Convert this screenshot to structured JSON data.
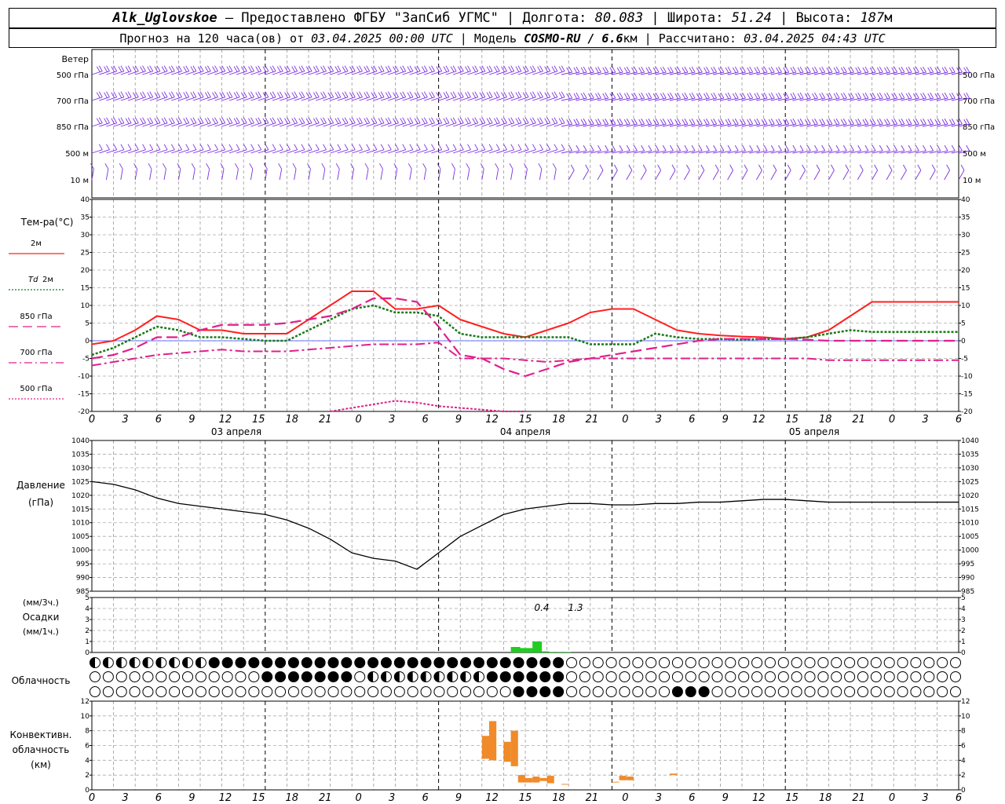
{
  "header": {
    "station": "Alk_Uglovskoe",
    "provider": "– Предоставлено ФГБУ \"ЗапСиб УГМС\"",
    "lon_label": "Долгота:",
    "lon": "80.083",
    "lat_label": "Широта:",
    "lat": "51.24",
    "alt_label": "Высота:",
    "alt": "187",
    "alt_unit": "м",
    "forecast_label": "Прогноз на 120 часа(ов) от",
    "forecast_start": "03.04.2025 00:00 UTC",
    "model_label": "Модель",
    "model": "COSMO-RU / 6.6",
    "model_unit": "км",
    "computed_label": "Рассчитано:",
    "computed": "03.04.2025 04:43 UTC"
  },
  "time_axis": {
    "hour_labels": [
      "0",
      "3",
      "6",
      "9",
      "12",
      "15",
      "18",
      "21",
      "0",
      "3",
      "6",
      "9",
      "12",
      "15",
      "18",
      "21",
      "0",
      "3",
      "6",
      "9",
      "12",
      "15",
      "18",
      "21",
      "0",
      "3",
      "6"
    ],
    "day_labels": [
      "03 апреля",
      "04 апреля",
      "05 апреля"
    ]
  },
  "wind": {
    "title": "Ветер",
    "levels": [
      "500 гПа",
      "700 гПа",
      "850 гПа",
      "500 м",
      "10  м"
    ],
    "color": "#7b2fe0"
  },
  "temperature": {
    "title": "Тем-ра(°C)",
    "legend": [
      {
        "label": "2м",
        "color": "#ff2020",
        "style": "solid"
      },
      {
        "label_it": "Td",
        "label": "2м",
        "color": "#1a7a1a",
        "style": "dotted"
      },
      {
        "label": "850 гПа",
        "color": "#e0208a",
        "style": "longdash"
      },
      {
        "label": "700 гПа",
        "color": "#e0208a",
        "style": "dashdot"
      },
      {
        "label": "500 гПа",
        "color": "#e0208a",
        "style": "dotted"
      }
    ],
    "y_ticks": [
      "40",
      "35",
      "30",
      "25",
      "20",
      "15",
      "10",
      "5",
      "0",
      "-5",
      "-10",
      "-15",
      "-20"
    ]
  },
  "pressure": {
    "title": "Давление",
    "unit": "(гПа)",
    "y_ticks": [
      "1040",
      "1035",
      "1030",
      "1025",
      "1020",
      "1015",
      "1010",
      "1005",
      "1000",
      "995",
      "990",
      "985"
    ]
  },
  "precip": {
    "unit3": "(мм/3ч.)",
    "title": "Осадки",
    "unit1": "(мм/1ч.)",
    "y_ticks": [
      "5",
      "4",
      "3",
      "2",
      "1",
      "0"
    ],
    "annotations": [
      "0.4",
      "1.3"
    ],
    "color": "#22cc22"
  },
  "cloud": {
    "title": "Облачность"
  },
  "convective": {
    "title1": "Конвективн.",
    "title2": "облачность",
    "unit": "(км)",
    "y_ticks": [
      "12",
      "10",
      "8",
      "6",
      "4",
      "2",
      "0"
    ],
    "color": "#f08a2a"
  },
  "chart_data": [
    {
      "type": "line",
      "title": "Тем-ра(°C)",
      "x_hours": [
        0,
        3,
        6,
        9,
        12,
        15,
        18,
        21,
        24,
        27,
        30,
        33,
        36,
        39,
        42,
        45,
        48,
        51,
        54,
        57,
        60,
        63,
        66,
        69,
        72,
        75,
        78,
        81,
        84,
        87,
        90,
        93,
        96,
        99,
        102,
        105,
        108,
        111,
        114,
        117,
        120
      ],
      "ylim": [
        -20,
        40
      ],
      "series": [
        {
          "name": "2м",
          "values": [
            -1,
            0,
            3,
            7,
            6,
            3,
            3,
            2,
            2,
            2,
            6,
            10,
            14,
            14,
            9,
            9,
            10,
            6,
            4,
            2,
            1,
            3,
            5,
            8,
            9,
            9,
            6,
            3,
            2,
            1.5,
            1.2,
            1,
            0.5,
            1,
            3,
            7,
            11,
            11,
            11,
            11,
            11
          ]
        },
        {
          "name": "Td 2м",
          "values": [
            -4,
            -2,
            1,
            4,
            3,
            1,
            1,
            0.5,
            0,
            0,
            3,
            6,
            9,
            10,
            8,
            8,
            7,
            2,
            1,
            1,
            1,
            1,
            1,
            -1,
            -1,
            -1,
            2,
            1,
            0.5,
            0.5,
            0.3,
            0.5,
            0.5,
            1,
            2,
            3,
            2.5,
            2.5,
            2.5,
            2.5,
            2.5
          ]
        },
        {
          "name": "850 гПа",
          "values": [
            -5,
            -4,
            -2,
            1,
            1,
            3,
            4.5,
            4.5,
            4.5,
            5,
            6,
            7,
            9,
            12,
            12,
            11,
            4,
            -4,
            -5,
            -8,
            -10,
            -8,
            -6,
            -5,
            -4,
            -3,
            -2,
            -1,
            0,
            0.5,
            0.5,
            0.5,
            0.5,
            0.3,
            0,
            0,
            0,
            0,
            0,
            0,
            0
          ]
        },
        {
          "name": "700 гПа",
          "values": [
            -7,
            -6,
            -5,
            -4,
            -3.5,
            -3,
            -2.5,
            -3,
            -3,
            -3,
            -2.5,
            -2,
            -1.5,
            -1,
            -1,
            -1,
            -0.5,
            -5,
            -5,
            -5,
            -5.5,
            -6,
            -5.5,
            -5,
            -5,
            -5,
            -5,
            -5,
            -5,
            -5,
            -5,
            -5,
            -5,
            -5,
            -5.5,
            -5.5,
            -5.5,
            -5.5,
            -5.5,
            -5.5,
            -5.5
          ]
        },
        {
          "name": "500 гПа",
          "x_hours": [
            33,
            36,
            39,
            42,
            45,
            48,
            51,
            54,
            57,
            60
          ],
          "values": [
            -20,
            -19,
            -18,
            -17,
            -17.5,
            -18.5,
            -19,
            -19.5,
            -20,
            -20
          ]
        }
      ]
    },
    {
      "type": "line",
      "title": "Давление",
      "x_hours": [
        0,
        3,
        6,
        9,
        12,
        15,
        18,
        21,
        24,
        27,
        30,
        33,
        36,
        39,
        42,
        45,
        48,
        51,
        54,
        57,
        60,
        63,
        66,
        69,
        72,
        75,
        78,
        81,
        84,
        87,
        90,
        93,
        96,
        99,
        102,
        105,
        108,
        111,
        114,
        117,
        120
      ],
      "ylim": [
        985,
        1040
      ],
      "values": [
        1025,
        1024,
        1022,
        1019,
        1017,
        1016,
        1015,
        1014,
        1013,
        1011,
        1008,
        1004,
        999,
        997,
        996,
        993,
        999,
        1005,
        1009,
        1013,
        1015,
        1016,
        1017,
        1017,
        1016.5,
        1016.5,
        1017,
        1017,
        1017.5,
        1017.5,
        1018,
        1018.5,
        1018.5,
        1018,
        1017.5,
        1017.5,
        1017.5,
        1017.5,
        1017.5,
        1017.5,
        1017.5
      ]
    },
    {
      "type": "bar",
      "title": "Осадки",
      "x_hours": [
        58,
        59,
        60,
        61,
        62,
        63,
        64,
        65
      ],
      "values": [
        0.5,
        0.4,
        0.4,
        1.0,
        0.1,
        0.05,
        0.05,
        0.05
      ],
      "ylim": [
        0,
        5
      ]
    },
    {
      "type": "bar",
      "title": "Конвективн. облачность",
      "segments": [
        {
          "x0": 54,
          "x1": 55,
          "bottom": 4.2,
          "top": 7.3
        },
        {
          "x0": 55,
          "x1": 56,
          "bottom": 4.0,
          "top": 9.3
        },
        {
          "x0": 57,
          "x1": 58,
          "bottom": 3.8,
          "top": 6.5
        },
        {
          "x0": 58,
          "x1": 59,
          "bottom": 3.2,
          "top": 8.0
        },
        {
          "x0": 59,
          "x1": 60,
          "bottom": 1.0,
          "top": 2.0
        },
        {
          "x0": 60,
          "x1": 61,
          "bottom": 1.0,
          "top": 1.6
        },
        {
          "x0": 61,
          "x1": 62,
          "bottom": 1.0,
          "top": 1.8
        },
        {
          "x0": 62,
          "x1": 63,
          "bottom": 1.2,
          "top": 1.6
        },
        {
          "x0": 63,
          "x1": 64,
          "bottom": 0.9,
          "top": 1.9
        },
        {
          "x0": 65,
          "x1": 66,
          "bottom": 0.7,
          "top": 0.8
        },
        {
          "x0": 72,
          "x1": 73,
          "bottom": 1.0,
          "top": 1.1
        },
        {
          "x0": 73,
          "x1": 74,
          "bottom": 1.3,
          "top": 1.9
        },
        {
          "x0": 74,
          "x1": 75,
          "bottom": 1.3,
          "top": 1.8
        },
        {
          "x0": 80,
          "x1": 81,
          "bottom": 2.0,
          "top": 2.2
        }
      ],
      "ylim": [
        0,
        12
      ]
    }
  ]
}
